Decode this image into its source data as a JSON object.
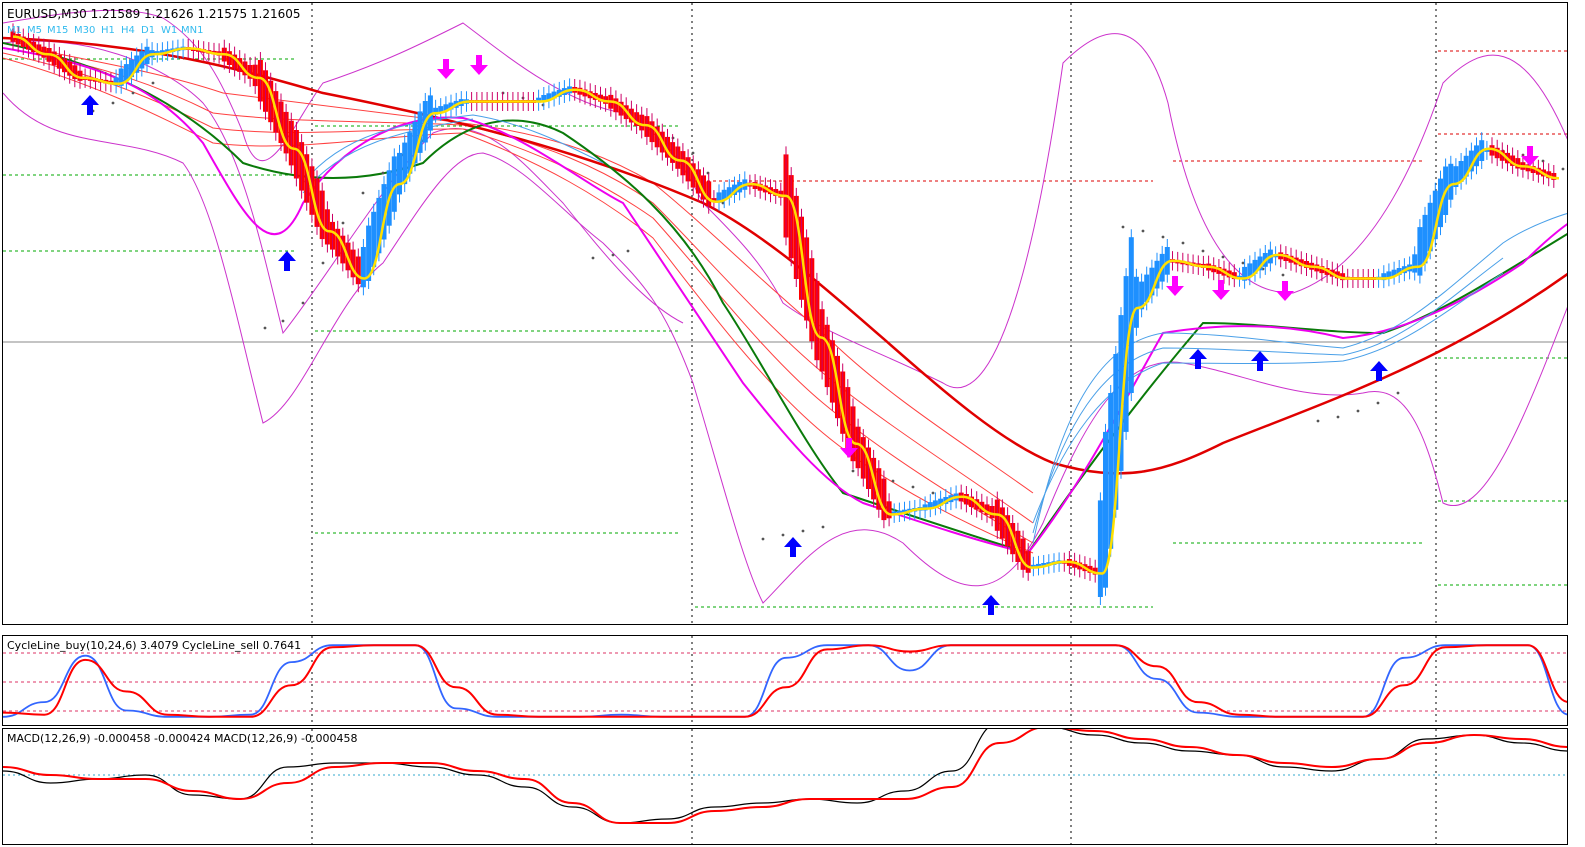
{
  "header": {
    "symbol_label": "EURUSD,M30  1.21589 1.21626 1.21575 1.21605",
    "timeframes": [
      "M1",
      "M5",
      "M15",
      "M30",
      "H1",
      "H4",
      "D1",
      "W1",
      "MN1"
    ]
  },
  "cycle_panel": {
    "label": "CycleLine_buy(10,24,6) 3.4079  CycleLine_sell 0.7641"
  },
  "macd_panel": {
    "label": "MACD(12,26,9) -0.000458 -0.000424  MACD(12,26,9) -0.000458"
  },
  "colors": {
    "bull_candle": "#1e90ff",
    "bear_candle": "#ff0000",
    "buy_arrow": "#0000ff",
    "sell_arrow": "#ff00ff",
    "band": "#cc33cc",
    "grid_red": "#dd0000",
    "grid_green": "#00aa00",
    "macd_main": "#000000",
    "macd_signal": "#ff0000",
    "cycle_buy": "#3366ff",
    "cycle_sell": "#ff0000"
  },
  "chart_data": [
    {
      "type": "line",
      "series": [
        {
          "name": "EURUSD,M30",
          "values": [
            1.2191,
            1.2188,
            1.2184,
            1.2183,
            1.2188,
            1.2189,
            1.2188,
            1.2184,
            1.2172,
            1.2158,
            1.215,
            1.2166,
            1.2178,
            1.218,
            1.218,
            1.218,
            1.2182,
            1.218,
            1.2176,
            1.217,
            1.2163,
            1.2166,
            1.2164,
            1.214,
            1.2122,
            1.211,
            1.2111,
            1.2113,
            1.211,
            1.2101,
            1.2102,
            1.21,
            1.2145,
            1.2153,
            1.2152,
            1.215,
            1.2154,
            1.2152,
            1.215,
            1.215,
            1.2152,
            1.2166,
            1.2172,
            1.2169,
            1.2167
          ]
        }
      ],
      "buy_arrows": 8,
      "sell_arrows": 7
    },
    {
      "type": "line",
      "series": [
        {
          "name": "CycleLine_buy",
          "values": [
            0.2,
            0.9,
            3.1,
            0.5,
            0.2,
            0.2,
            0.3,
            2.8,
            3.6,
            3.6,
            3.6,
            0.6,
            0.2,
            0.2,
            0.2,
            0.3,
            0.2,
            0.2,
            0.2,
            3.0,
            3.6,
            3.6,
            2.4,
            3.6,
            3.6,
            3.6,
            3.6,
            3.6,
            2.0,
            0.4,
            0.2,
            0.2,
            0.2,
            0.2,
            3.0,
            3.6,
            3.6,
            3.6,
            0.3
          ]
        },
        {
          "name": "CycleLine_sell",
          "values": [
            0.4,
            0.3,
            2.9,
            1.4,
            0.3,
            0.2,
            0.2,
            1.7,
            3.5,
            3.6,
            3.6,
            1.6,
            0.3,
            0.2,
            0.2,
            0.2,
            0.2,
            0.2,
            0.2,
            1.6,
            3.4,
            3.6,
            3.3,
            3.6,
            3.6,
            3.6,
            3.6,
            3.6,
            2.6,
            0.9,
            0.3,
            0.2,
            0.2,
            0.2,
            1.7,
            3.5,
            3.6,
            3.6,
            0.9
          ]
        }
      ],
      "levels": [
        0.76,
        2.0,
        3.4
      ]
    },
    {
      "type": "line",
      "series": [
        {
          "name": "MACD(12,26,9)",
          "values": [
            0.0001,
            -0.0002,
            -0.0001,
            0.0,
            -0.0005,
            -0.0006,
            0.0002,
            0.0003,
            0.0003,
            0.0002,
            0.0,
            -0.0003,
            -0.0008,
            -0.0012,
            -0.0011,
            -0.0008,
            -0.0007,
            -0.0006,
            -0.0007,
            -0.0004,
            0.0001,
            0.0013,
            0.0012,
            0.001,
            0.0008,
            0.0006,
            0.0005,
            0.0002,
            0.0001,
            0.0004,
            0.0009,
            0.001,
            0.0008,
            0.0006
          ]
        },
        {
          "name": "Signal",
          "values": [
            0.0002,
            0.0,
            -0.0001,
            -0.0001,
            -0.0004,
            -0.0006,
            -0.0002,
            0.0002,
            0.0003,
            0.0003,
            0.0001,
            -0.0001,
            -0.0007,
            -0.0012,
            -0.0012,
            -0.0009,
            -0.0008,
            -0.0006,
            -0.0006,
            -0.0006,
            -0.0003,
            0.0008,
            0.0012,
            0.0011,
            0.0009,
            0.0007,
            0.0005,
            0.0003,
            0.0002,
            0.0004,
            0.0008,
            0.001,
            0.0009,
            0.0007
          ]
        }
      ]
    }
  ]
}
